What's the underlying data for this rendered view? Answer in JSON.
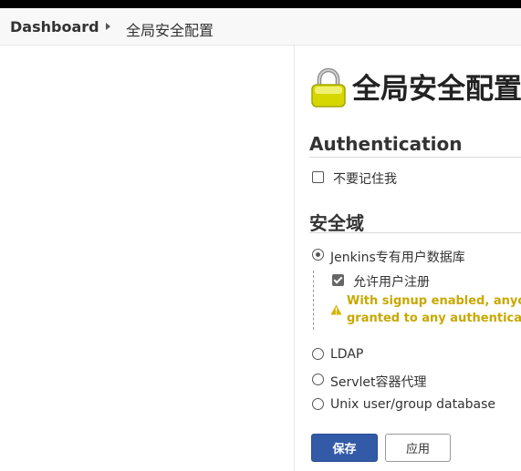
{
  "breadcrumb": {
    "dashboard": "Dashboard",
    "current": "全局安全配置"
  },
  "page": {
    "title": "全局安全配置"
  },
  "authentication": {
    "title": "Authentication",
    "remember_me_label": "不要记住我",
    "remember_me_checked": false
  },
  "security_realm": {
    "title": "安全域",
    "options": [
      {
        "label": "Jenkins专有用户数据库",
        "selected": true
      },
      {
        "label": "LDAP",
        "selected": false
      },
      {
        "label": "Servlet容器代理",
        "selected": false
      },
      {
        "label": "Unix user/group database",
        "selected": false
      }
    ],
    "allow_signup_label": "允许用户注册",
    "allow_signup_checked": true,
    "warning_line1": "With signup enabled, anyone",
    "warning_line2": "granted to any authenticated"
  },
  "buttons": {
    "save": "保存",
    "apply": "应用"
  },
  "colors": {
    "primary": "#335aa7",
    "warning": "#c8a800"
  }
}
